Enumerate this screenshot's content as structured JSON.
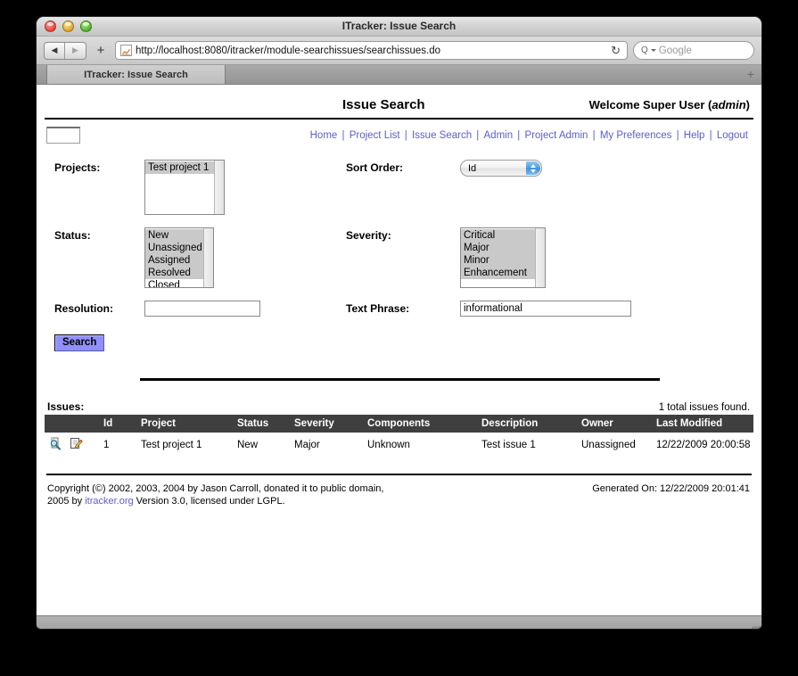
{
  "window": {
    "title": "ITracker: Issue Search",
    "traffic_lights": [
      "close",
      "minimize",
      "zoom"
    ]
  },
  "toolbar": {
    "back_glyph": "◀",
    "forward_glyph": "▶",
    "add_glyph": "+",
    "url": "http://localhost:8080/itracker/module-searchissues/searchissues.do",
    "reload_glyph": "↻",
    "search_label": "Q",
    "search_placeholder": "Google"
  },
  "tabs": {
    "active_label": "ITracker: Issue Search",
    "new_tab_glyph": "+"
  },
  "page": {
    "title": "Issue Search",
    "welcome_prefix": "Welcome Super User (",
    "welcome_user": "admin",
    "welcome_suffix": ")",
    "nav_links": [
      "Home",
      "Project List",
      "Issue Search",
      "Admin",
      "Project Admin",
      "My Preferences",
      "Help",
      "Logout"
    ],
    "nav_separator": "|"
  },
  "form": {
    "projects_label": "Projects:",
    "projects_options": [
      {
        "label": "Test project 1",
        "selected": true
      }
    ],
    "sort_order_label": "Sort Order:",
    "sort_order_value": "Id",
    "status_label": "Status:",
    "status_options": [
      {
        "label": "New",
        "selected": true
      },
      {
        "label": "Unassigned",
        "selected": true
      },
      {
        "label": "Assigned",
        "selected": true
      },
      {
        "label": "Resolved",
        "selected": true
      },
      {
        "label": "Closed",
        "selected": false
      }
    ],
    "severity_label": "Severity:",
    "severity_options": [
      {
        "label": "Critical",
        "selected": true
      },
      {
        "label": "Major",
        "selected": true
      },
      {
        "label": "Minor",
        "selected": true
      },
      {
        "label": "Enhancement",
        "selected": true
      },
      {
        "label": "",
        "selected": false
      }
    ],
    "resolution_label": "Resolution:",
    "resolution_value": "",
    "resolution_placeholder": "",
    "text_phrase_label": "Text Phrase:",
    "text_phrase_value": "informational",
    "text_phrase_placeholder": "",
    "search_button_label": "Search"
  },
  "issues": {
    "label": "Issues:",
    "count_text": "1 total issues found.",
    "columns": [
      "",
      "Id",
      "Project",
      "Status",
      "Severity",
      "Components",
      "Description",
      "Owner",
      "Last Modified"
    ],
    "rows": [
      {
        "view_icon": "magnifier-icon",
        "edit_icon": "pencil-icon",
        "id": "1",
        "project": "Test project 1",
        "status": "New",
        "severity": "Major",
        "components": "Unknown",
        "description": "Test issue 1",
        "owner": "Unassigned",
        "last_modified": "12/22/2009 20:00:58"
      }
    ]
  },
  "footer": {
    "copyright_line1": "Copyright (©) 2002, 2003, 2004 by Jason Carroll, donated it to public domain,",
    "copyright_line2_pre": "2005 by ",
    "copyright_link": "itracker.org",
    "copyright_line2_post": " Version 3.0, licensed under LGPL.",
    "generated_on": "Generated On: 12/22/2009 20:01:41"
  },
  "colors": {
    "link": "#5b5bd6",
    "table_header_bg": "#3f3f3f",
    "search_button_bg": "#8f8fff",
    "listbox_selected_bg": "#c9c9c9"
  }
}
